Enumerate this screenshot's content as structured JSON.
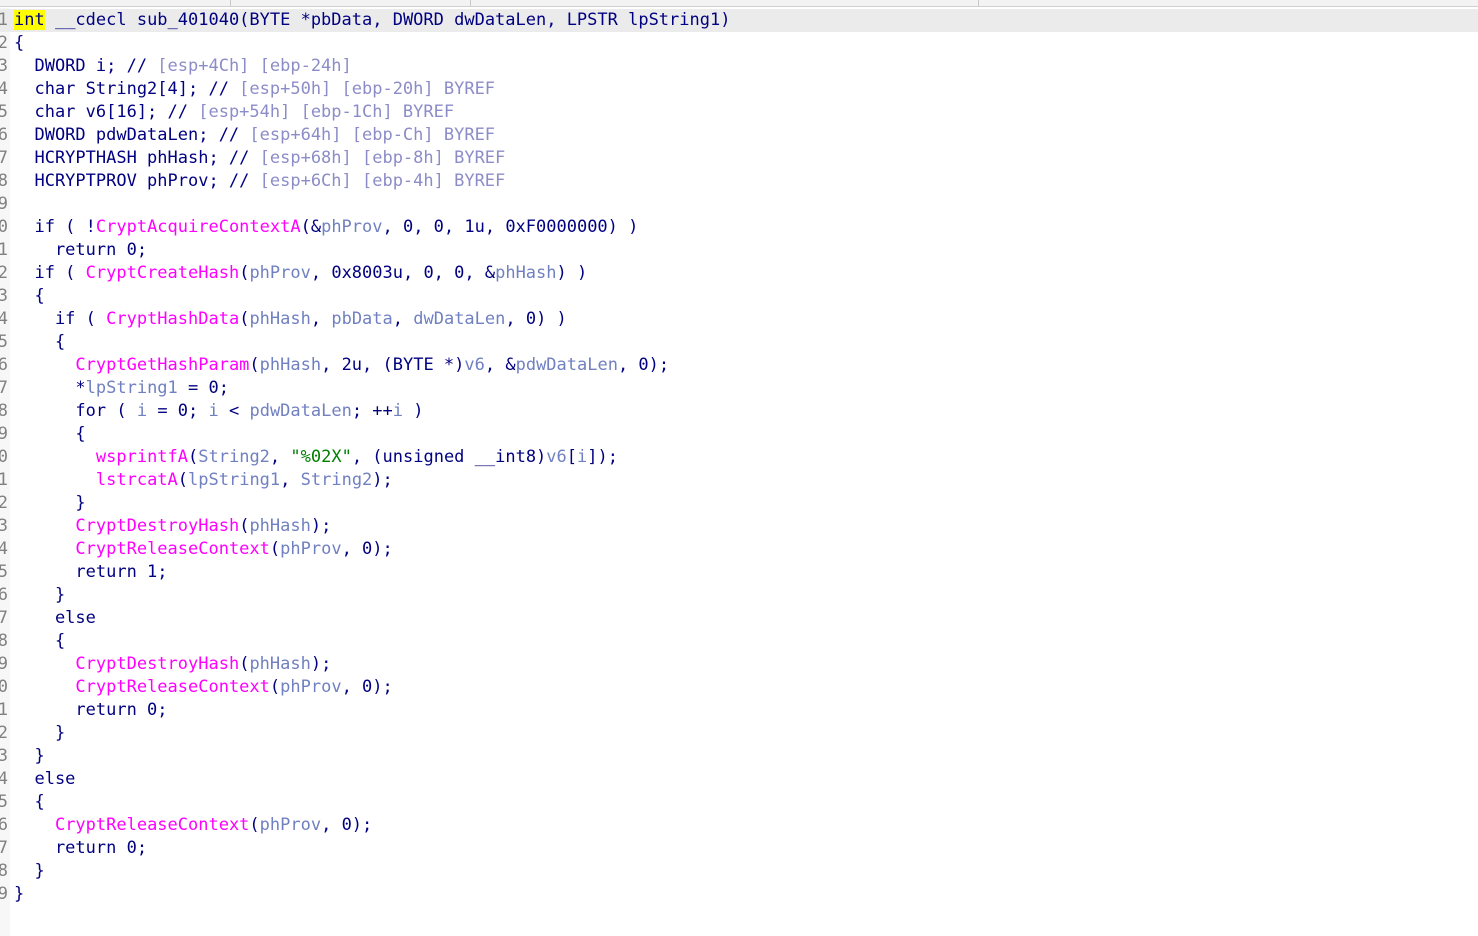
{
  "code_lines": [
    {
      "n": "1",
      "segs": [
        {
          "t": "int",
          "c": "hl"
        },
        {
          "t": " __cdecl sub_401040(BYTE *pbData, DWORD dwDataLen, LPSTR lpString1)",
          "c": "kw"
        }
      ]
    },
    {
      "n": "2",
      "segs": [
        {
          "t": "{",
          "c": "kw"
        }
      ]
    },
    {
      "n": "3",
      "segs": [
        {
          "t": "  DWORD i; // ",
          "c": "kw"
        },
        {
          "t": "[esp+4Ch] [ebp-24h]",
          "c": "ann"
        }
      ]
    },
    {
      "n": "4",
      "segs": [
        {
          "t": "  char String2[4]; // ",
          "c": "kw"
        },
        {
          "t": "[esp+50h] [ebp-20h] BYREF",
          "c": "ann"
        }
      ]
    },
    {
      "n": "5",
      "segs": [
        {
          "t": "  char v6[16]; // ",
          "c": "kw"
        },
        {
          "t": "[esp+54h] [ebp-1Ch] BYREF",
          "c": "ann"
        }
      ]
    },
    {
      "n": "6",
      "segs": [
        {
          "t": "  DWORD pdwDataLen; // ",
          "c": "kw"
        },
        {
          "t": "[esp+64h] [ebp-Ch] BYREF",
          "c": "ann"
        }
      ]
    },
    {
      "n": "7",
      "segs": [
        {
          "t": "  HCRYPTHASH phHash; // ",
          "c": "kw"
        },
        {
          "t": "[esp+68h] [ebp-8h] BYREF",
          "c": "ann"
        }
      ]
    },
    {
      "n": "8",
      "segs": [
        {
          "t": "  HCRYPTPROV phProv; // ",
          "c": "kw"
        },
        {
          "t": "[esp+6Ch] [ebp-4h] BYREF",
          "c": "ann"
        }
      ]
    },
    {
      "n": "9",
      "segs": []
    },
    {
      "n": "0",
      "segs": [
        {
          "t": "  if ( !",
          "c": "kw"
        },
        {
          "t": "CryptAcquireContextA",
          "c": "fn"
        },
        {
          "t": "(&",
          "c": "kw"
        },
        {
          "t": "phProv",
          "c": "var"
        },
        {
          "t": ", 0, 0, 1u, 0xF0000000) )",
          "c": "kw"
        }
      ]
    },
    {
      "n": "1",
      "segs": [
        {
          "t": "    return 0;",
          "c": "kw"
        }
      ]
    },
    {
      "n": "2",
      "segs": [
        {
          "t": "  if ( ",
          "c": "kw"
        },
        {
          "t": "CryptCreateHash",
          "c": "fn"
        },
        {
          "t": "(",
          "c": "kw"
        },
        {
          "t": "phProv",
          "c": "var"
        },
        {
          "t": ", 0x8003u, 0, 0, &",
          "c": "kw"
        },
        {
          "t": "phHash",
          "c": "var"
        },
        {
          "t": ") )",
          "c": "kw"
        }
      ]
    },
    {
      "n": "3",
      "segs": [
        {
          "t": "  {",
          "c": "kw"
        }
      ]
    },
    {
      "n": "4",
      "segs": [
        {
          "t": "    if ( ",
          "c": "kw"
        },
        {
          "t": "CryptHashData",
          "c": "fn"
        },
        {
          "t": "(",
          "c": "kw"
        },
        {
          "t": "phHash",
          "c": "var"
        },
        {
          "t": ", ",
          "c": "kw"
        },
        {
          "t": "pbData",
          "c": "var"
        },
        {
          "t": ", ",
          "c": "kw"
        },
        {
          "t": "dwDataLen",
          "c": "var"
        },
        {
          "t": ", 0) )",
          "c": "kw"
        }
      ]
    },
    {
      "n": "5",
      "segs": [
        {
          "t": "    {",
          "c": "kw"
        }
      ]
    },
    {
      "n": "6",
      "segs": [
        {
          "t": "      ",
          "c": "kw"
        },
        {
          "t": "CryptGetHashParam",
          "c": "fn"
        },
        {
          "t": "(",
          "c": "kw"
        },
        {
          "t": "phHash",
          "c": "var"
        },
        {
          "t": ", 2u, (BYTE *)",
          "c": "kw"
        },
        {
          "t": "v6",
          "c": "var"
        },
        {
          "t": ", &",
          "c": "kw"
        },
        {
          "t": "pdwDataLen",
          "c": "var"
        },
        {
          "t": ", 0);",
          "c": "kw"
        }
      ]
    },
    {
      "n": "7",
      "segs": [
        {
          "t": "      *",
          "c": "kw"
        },
        {
          "t": "lpString1",
          "c": "var"
        },
        {
          "t": " = 0;",
          "c": "kw"
        }
      ]
    },
    {
      "n": "8",
      "segs": [
        {
          "t": "      for ( ",
          "c": "kw"
        },
        {
          "t": "i",
          "c": "var"
        },
        {
          "t": " = 0; ",
          "c": "kw"
        },
        {
          "t": "i",
          "c": "var"
        },
        {
          "t": " < ",
          "c": "kw"
        },
        {
          "t": "pdwDataLen",
          "c": "var"
        },
        {
          "t": "; ++",
          "c": "kw"
        },
        {
          "t": "i",
          "c": "var"
        },
        {
          "t": " )",
          "c": "kw"
        }
      ]
    },
    {
      "n": "9",
      "segs": [
        {
          "t": "      {",
          "c": "kw"
        }
      ]
    },
    {
      "n": "0",
      "segs": [
        {
          "t": "        ",
          "c": "kw"
        },
        {
          "t": "wsprintfA",
          "c": "fn"
        },
        {
          "t": "(",
          "c": "kw"
        },
        {
          "t": "String2",
          "c": "var"
        },
        {
          "t": ", ",
          "c": "kw"
        },
        {
          "t": "\"%02X\"",
          "c": "str"
        },
        {
          "t": ", (unsigned __int8)",
          "c": "kw"
        },
        {
          "t": "v6",
          "c": "var"
        },
        {
          "t": "[",
          "c": "kw"
        },
        {
          "t": "i",
          "c": "var"
        },
        {
          "t": "]);",
          "c": "kw"
        }
      ]
    },
    {
      "n": "1",
      "segs": [
        {
          "t": "        ",
          "c": "kw"
        },
        {
          "t": "lstrcatA",
          "c": "fn"
        },
        {
          "t": "(",
          "c": "kw"
        },
        {
          "t": "lpString1",
          "c": "var"
        },
        {
          "t": ", ",
          "c": "kw"
        },
        {
          "t": "String2",
          "c": "var"
        },
        {
          "t": ");",
          "c": "kw"
        }
      ]
    },
    {
      "n": "2",
      "segs": [
        {
          "t": "      }",
          "c": "kw"
        }
      ]
    },
    {
      "n": "3",
      "segs": [
        {
          "t": "      ",
          "c": "kw"
        },
        {
          "t": "CryptDestroyHash",
          "c": "fn"
        },
        {
          "t": "(",
          "c": "kw"
        },
        {
          "t": "phHash",
          "c": "var"
        },
        {
          "t": ");",
          "c": "kw"
        }
      ]
    },
    {
      "n": "4",
      "segs": [
        {
          "t": "      ",
          "c": "kw"
        },
        {
          "t": "CryptReleaseContext",
          "c": "fn"
        },
        {
          "t": "(",
          "c": "kw"
        },
        {
          "t": "phProv",
          "c": "var"
        },
        {
          "t": ", 0);",
          "c": "kw"
        }
      ]
    },
    {
      "n": "5",
      "segs": [
        {
          "t": "      return 1;",
          "c": "kw"
        }
      ]
    },
    {
      "n": "6",
      "segs": [
        {
          "t": "    }",
          "c": "kw"
        }
      ]
    },
    {
      "n": "7",
      "segs": [
        {
          "t": "    else",
          "c": "kw"
        }
      ]
    },
    {
      "n": "8",
      "segs": [
        {
          "t": "    {",
          "c": "kw"
        }
      ]
    },
    {
      "n": "9",
      "segs": [
        {
          "t": "      ",
          "c": "kw"
        },
        {
          "t": "CryptDestroyHash",
          "c": "fn"
        },
        {
          "t": "(",
          "c": "kw"
        },
        {
          "t": "phHash",
          "c": "var"
        },
        {
          "t": ");",
          "c": "kw"
        }
      ]
    },
    {
      "n": "0",
      "segs": [
        {
          "t": "      ",
          "c": "kw"
        },
        {
          "t": "CryptReleaseContext",
          "c": "fn"
        },
        {
          "t": "(",
          "c": "kw"
        },
        {
          "t": "phProv",
          "c": "var"
        },
        {
          "t": ", 0);",
          "c": "kw"
        }
      ]
    },
    {
      "n": "1",
      "segs": [
        {
          "t": "      return 0;",
          "c": "kw"
        }
      ]
    },
    {
      "n": "2",
      "segs": [
        {
          "t": "    }",
          "c": "kw"
        }
      ]
    },
    {
      "n": "3",
      "segs": [
        {
          "t": "  }",
          "c": "kw"
        }
      ]
    },
    {
      "n": "4",
      "segs": [
        {
          "t": "  else",
          "c": "kw"
        }
      ]
    },
    {
      "n": "5",
      "segs": [
        {
          "t": "  {",
          "c": "kw"
        }
      ]
    },
    {
      "n": "6",
      "segs": [
        {
          "t": "    ",
          "c": "kw"
        },
        {
          "t": "CryptReleaseContext",
          "c": "fn"
        },
        {
          "t": "(",
          "c": "kw"
        },
        {
          "t": "phProv",
          "c": "var"
        },
        {
          "t": ", 0);",
          "c": "kw"
        }
      ]
    },
    {
      "n": "7",
      "segs": [
        {
          "t": "    return 0;",
          "c": "kw"
        }
      ]
    },
    {
      "n": "8",
      "segs": [
        {
          "t": "  }",
          "c": "kw"
        }
      ]
    },
    {
      "n": "9",
      "segs": [
        {
          "t": "}",
          "c": "kw"
        }
      ]
    }
  ],
  "colors": {
    "keyword": "#000080",
    "function": "#ff00ff",
    "variable": "#7080c0",
    "annotation": "#8c8cc8",
    "string": "#008000",
    "highlight": "#ffff00",
    "line_number": "#808080"
  }
}
